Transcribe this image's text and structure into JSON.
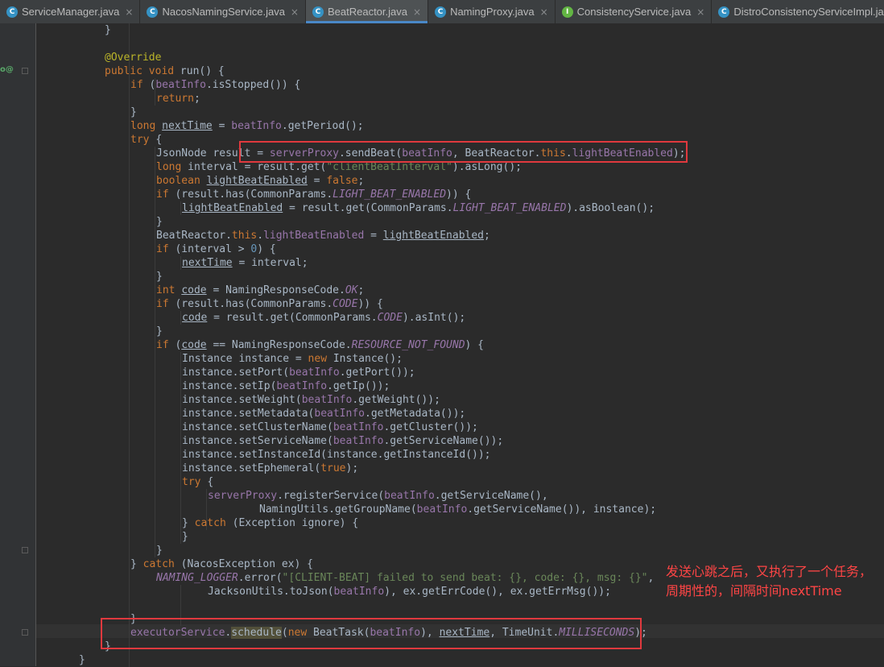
{
  "tabs": [
    {
      "label": "ServiceManager.java",
      "type": "C",
      "color": "#3592c4",
      "active": false
    },
    {
      "label": "NacosNamingService.java",
      "type": "C",
      "color": "#3592c4",
      "active": false
    },
    {
      "label": "BeatReactor.java",
      "type": "C",
      "color": "#3592c4",
      "active": true
    },
    {
      "label": "NamingProxy.java",
      "type": "C",
      "color": "#3592c4",
      "active": false
    },
    {
      "label": "ConsistencyService.java",
      "type": "I",
      "color": "#62b543",
      "active": false
    },
    {
      "label": "DistroConsistencyServiceImpl.java",
      "type": "C",
      "color": "#3592c4",
      "active": false
    }
  ],
  "tab_close_glyph": "×",
  "gutter_marker": "o@",
  "code_lines": [
    {
      "indent": 2,
      "tokens": [
        [
          "}",
          ""
        ]
      ]
    },
    {
      "indent": 0,
      "tokens": []
    },
    {
      "indent": 2,
      "tokens": [
        [
          "@Override",
          "ann"
        ]
      ]
    },
    {
      "indent": 2,
      "tokens": [
        [
          "public void ",
          "kw"
        ],
        [
          "run() {",
          ""
        ]
      ]
    },
    {
      "indent": 3,
      "tokens": [
        [
          "if ",
          "kw"
        ],
        [
          "(",
          ""
        ],
        [
          "beatInfo",
          "fld"
        ],
        [
          ".isStopped()) {",
          ""
        ]
      ]
    },
    {
      "indent": 4,
      "tokens": [
        [
          "return",
          "kw"
        ],
        [
          ";",
          ""
        ]
      ]
    },
    {
      "indent": 3,
      "tokens": [
        [
          "}",
          ""
        ]
      ]
    },
    {
      "indent": 3,
      "tokens": [
        [
          "long ",
          "kw"
        ],
        [
          "nextTime",
          "ul"
        ],
        [
          " = ",
          ""
        ],
        [
          "beatInfo",
          "fld"
        ],
        [
          ".getPeriod();",
          ""
        ]
      ]
    },
    {
      "indent": 3,
      "tokens": [
        [
          "try ",
          "kw"
        ],
        [
          "{",
          ""
        ]
      ]
    },
    {
      "indent": 4,
      "tokens": [
        [
          "JsonNode result = ",
          ""
        ],
        [
          "serverProxy",
          "fld"
        ],
        [
          ".sendBeat(",
          ""
        ],
        [
          "beatInfo",
          "fld"
        ],
        [
          ", BeatReactor.",
          ""
        ],
        [
          "this",
          "kw"
        ],
        [
          ".",
          ""
        ],
        [
          "lightBeatEnabled",
          "fld"
        ],
        [
          ");",
          ""
        ]
      ]
    },
    {
      "indent": 4,
      "tokens": [
        [
          "long ",
          "kw"
        ],
        [
          "interval = result.get(",
          ""
        ],
        [
          "\"clientBeatInterval\"",
          "str"
        ],
        [
          ").asLong();",
          ""
        ]
      ]
    },
    {
      "indent": 4,
      "tokens": [
        [
          "boolean ",
          "kw"
        ],
        [
          "lightBeatEnabled",
          "ul"
        ],
        [
          " = ",
          ""
        ],
        [
          "false",
          "kw"
        ],
        [
          ";",
          ""
        ]
      ]
    },
    {
      "indent": 4,
      "tokens": [
        [
          "if ",
          "kw"
        ],
        [
          "(result.has(CommonParams.",
          ""
        ],
        [
          "LIGHT_BEAT_ENABLED",
          "fld it"
        ],
        [
          ")) {",
          ""
        ]
      ]
    },
    {
      "indent": 5,
      "tokens": [
        [
          "lightBeatEnabled",
          "ul"
        ],
        [
          " = result.get(CommonParams.",
          ""
        ],
        [
          "LIGHT_BEAT_ENABLED",
          "fld it"
        ],
        [
          ").asBoolean();",
          ""
        ]
      ]
    },
    {
      "indent": 4,
      "tokens": [
        [
          "}",
          ""
        ]
      ]
    },
    {
      "indent": 4,
      "tokens": [
        [
          "BeatReactor.",
          ""
        ],
        [
          "this",
          "kw"
        ],
        [
          ".",
          ""
        ],
        [
          "lightBeatEnabled",
          "fld"
        ],
        [
          " = ",
          ""
        ],
        [
          "lightBeatEnabled",
          "ul"
        ],
        [
          ";",
          ""
        ]
      ]
    },
    {
      "indent": 4,
      "tokens": [
        [
          "if ",
          "kw"
        ],
        [
          "(interval > ",
          ""
        ],
        [
          "0",
          "num"
        ],
        [
          ") {",
          ""
        ]
      ]
    },
    {
      "indent": 5,
      "tokens": [
        [
          "nextTime",
          "ul"
        ],
        [
          " = interval;",
          ""
        ]
      ]
    },
    {
      "indent": 4,
      "tokens": [
        [
          "}",
          ""
        ]
      ]
    },
    {
      "indent": 4,
      "tokens": [
        [
          "int ",
          "kw"
        ],
        [
          "code",
          "ul"
        ],
        [
          " = NamingResponseCode.",
          ""
        ],
        [
          "OK",
          "fld it"
        ],
        [
          ";",
          ""
        ]
      ]
    },
    {
      "indent": 4,
      "tokens": [
        [
          "if ",
          "kw"
        ],
        [
          "(result.has(CommonParams.",
          ""
        ],
        [
          "CODE",
          "fld it"
        ],
        [
          ")) {",
          ""
        ]
      ]
    },
    {
      "indent": 5,
      "tokens": [
        [
          "code",
          "ul"
        ],
        [
          " = result.get(CommonParams.",
          ""
        ],
        [
          "CODE",
          "fld it"
        ],
        [
          ").asInt();",
          ""
        ]
      ]
    },
    {
      "indent": 4,
      "tokens": [
        [
          "}",
          ""
        ]
      ]
    },
    {
      "indent": 4,
      "tokens": [
        [
          "if ",
          "kw"
        ],
        [
          "(",
          ""
        ],
        [
          "code",
          "ul"
        ],
        [
          " == NamingResponseCode.",
          ""
        ],
        [
          "RESOURCE_NOT_FOUND",
          "fld it"
        ],
        [
          ") {",
          ""
        ]
      ]
    },
    {
      "indent": 5,
      "tokens": [
        [
          "Instance instance = ",
          ""
        ],
        [
          "new ",
          "kw"
        ],
        [
          "Instance();",
          ""
        ]
      ]
    },
    {
      "indent": 5,
      "tokens": [
        [
          "instance.setPort(",
          ""
        ],
        [
          "beatInfo",
          "fld"
        ],
        [
          ".getPort());",
          ""
        ]
      ]
    },
    {
      "indent": 5,
      "tokens": [
        [
          "instance.setIp(",
          ""
        ],
        [
          "beatInfo",
          "fld"
        ],
        [
          ".getIp());",
          ""
        ]
      ]
    },
    {
      "indent": 5,
      "tokens": [
        [
          "instance.setWeight(",
          ""
        ],
        [
          "beatInfo",
          "fld"
        ],
        [
          ".getWeight());",
          ""
        ]
      ]
    },
    {
      "indent": 5,
      "tokens": [
        [
          "instance.setMetadata(",
          ""
        ],
        [
          "beatInfo",
          "fld"
        ],
        [
          ".getMetadata());",
          ""
        ]
      ]
    },
    {
      "indent": 5,
      "tokens": [
        [
          "instance.setClusterName(",
          ""
        ],
        [
          "beatInfo",
          "fld"
        ],
        [
          ".getCluster());",
          ""
        ]
      ]
    },
    {
      "indent": 5,
      "tokens": [
        [
          "instance.setServiceName(",
          ""
        ],
        [
          "beatInfo",
          "fld"
        ],
        [
          ".getServiceName());",
          ""
        ]
      ]
    },
    {
      "indent": 5,
      "tokens": [
        [
          "instance.setInstanceId(instance.getInstanceId());",
          ""
        ]
      ]
    },
    {
      "indent": 5,
      "tokens": [
        [
          "instance.setEphemeral(",
          ""
        ],
        [
          "true",
          "kw"
        ],
        [
          ");",
          ""
        ]
      ]
    },
    {
      "indent": 5,
      "tokens": [
        [
          "try ",
          "kw"
        ],
        [
          "{",
          ""
        ]
      ]
    },
    {
      "indent": 6,
      "tokens": [
        [
          "serverProxy",
          "fld"
        ],
        [
          ".registerService(",
          ""
        ],
        [
          "beatInfo",
          "fld"
        ],
        [
          ".getServiceName(),",
          ""
        ]
      ]
    },
    {
      "indent": 8,
      "tokens": [
        [
          "NamingUtils.getGroupName(",
          ""
        ],
        [
          "beatInfo",
          "fld"
        ],
        [
          ".getServiceName()), instance);",
          ""
        ]
      ]
    },
    {
      "indent": 5,
      "tokens": [
        [
          "} ",
          ""
        ],
        [
          "catch ",
          "kw"
        ],
        [
          "(Exception ignore) {",
          ""
        ]
      ]
    },
    {
      "indent": 5,
      "tokens": [
        [
          "}",
          ""
        ]
      ]
    },
    {
      "indent": 4,
      "tokens": [
        [
          "}",
          ""
        ]
      ]
    },
    {
      "indent": 3,
      "tokens": [
        [
          "} ",
          ""
        ],
        [
          "catch ",
          "kw"
        ],
        [
          "(NacosException ex) {",
          ""
        ]
      ]
    },
    {
      "indent": 4,
      "tokens": [
        [
          "NAMING_LOGGER",
          "fld it"
        ],
        [
          ".error(",
          ""
        ],
        [
          "\"[CLIENT-BEAT] failed to send beat: {}, code: {}, msg: {}\"",
          "str"
        ],
        [
          ",",
          ""
        ]
      ]
    },
    {
      "indent": 6,
      "tokens": [
        [
          "JacksonUtils.toJson(",
          ""
        ],
        [
          "beatInfo",
          "fld"
        ],
        [
          "), ex.getErrCode(), ex.getErrMsg());",
          ""
        ]
      ]
    },
    {
      "indent": 0,
      "tokens": []
    },
    {
      "indent": 3,
      "tokens": [
        [
          "}",
          ""
        ]
      ]
    },
    {
      "indent": 3,
      "tokens": [
        [
          "executorService",
          "fld"
        ],
        [
          ".",
          ""
        ],
        [
          "schedule",
          "hl"
        ],
        [
          "(",
          ""
        ],
        [
          "new ",
          "kw"
        ],
        [
          "BeatTask(",
          ""
        ],
        [
          "beatInfo",
          "fld"
        ],
        [
          "), ",
          ""
        ],
        [
          "nextTime",
          "ul"
        ],
        [
          ", TimeUnit.",
          ""
        ],
        [
          "MILLISECONDS",
          "fld it"
        ],
        [
          ");",
          ""
        ]
      ]
    },
    {
      "indent": 2,
      "tokens": [
        [
          "}",
          ""
        ]
      ]
    },
    {
      "indent": 1,
      "tokens": [
        [
          "}",
          ""
        ]
      ]
    }
  ],
  "annotation_note": {
    "line1": "发送心跳之后，又执行了一个任务，",
    "line2": "周期性的，间隔时间nextTime"
  },
  "colors": {
    "editor_bg": "#2b2b2b",
    "gutter_bg": "#313335",
    "tabbar_bg": "#3c3f41",
    "keyword": "#cc7832",
    "field": "#9876aa",
    "string": "#6a8759",
    "number": "#6897bb",
    "annotation": "#bbb529",
    "plain": "#a9b7c6",
    "callout": "#e0393e"
  }
}
